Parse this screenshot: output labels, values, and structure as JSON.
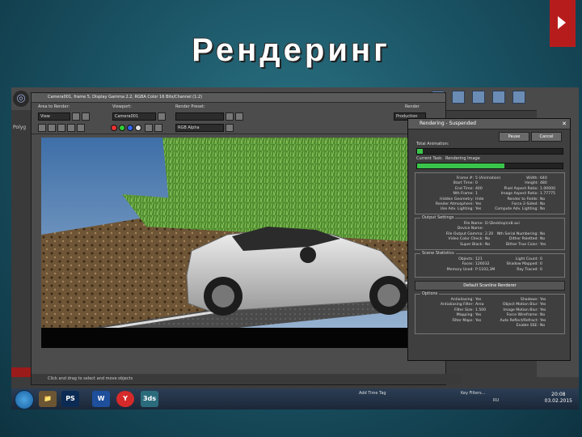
{
  "slide": {
    "title": "Рендеринг"
  },
  "max": {
    "side_labels": [
      "Polyg"
    ]
  },
  "frame": {
    "title": "Camera001, frame 5, Display Gamma 2.2, RGBA Color 16 Bits/Channel (1:2)",
    "area_label": "Area to Render:",
    "area_value": "View",
    "viewport_label": "Viewport:",
    "viewport_value": "Camera001",
    "preset_label": "Render Preset:",
    "channel_value": "RGB Alpha",
    "render_label": "Render",
    "render_value": "Production",
    "status": "Click and drag to select and move objects"
  },
  "rendering": {
    "title": "Rendering - Suspended",
    "pause_label": "Pause",
    "cancel_label": "Cancel",
    "total_label": "Total Animation:",
    "current_label": "Current Task:",
    "current_value": "Rendering Image",
    "total_progress": 0.04,
    "current_progress": 0.6,
    "common": [
      {
        "l": "Frame #:",
        "r": "5 (Animation)",
        "l2": "Width:",
        "r2": "640"
      },
      {
        "l": "Start Time:",
        "r": "0",
        "l2": "Height:",
        "r2": "480"
      },
      {
        "l": "End Time:",
        "r": "400",
        "l2": "Pixel Aspect Ratio:",
        "r2": "1.00000"
      },
      {
        "l": "Nth Frame:",
        "r": "1",
        "l2": "Image Aspect Ratio:",
        "r2": "1.77775"
      },
      {
        "l": "Hidden Geometry:",
        "r": "Hide",
        "l2": "Render to Fields:",
        "r2": "No"
      },
      {
        "l": "Render Atmosphere:",
        "r": "Yes",
        "l2": "Force 2-Sided:",
        "r2": "No"
      },
      {
        "l": "Use Adv. Lighting:",
        "r": "Yes",
        "l2": "Compute Adv. Lighting:",
        "r2": "No"
      }
    ],
    "output_title": "Output Settings",
    "output": [
      {
        "l": "File Name:",
        "r": "D:\\Desktop\\rx8.avi",
        "l2": "",
        "r2": ""
      },
      {
        "l": "Device Name:",
        "r": "",
        "l2": "",
        "r2": ""
      },
      {
        "l": "File Output Gamma:",
        "r": "2.20",
        "l2": "Nth Serial Numbering:",
        "r2": "No"
      },
      {
        "l": "Video Color Check:",
        "r": "No",
        "l2": "Dither Paletted:",
        "r2": "No"
      },
      {
        "l": "Super Black:",
        "r": "No",
        "l2": "Dither True Color:",
        "r2": "Yes"
      }
    ],
    "scene_title": "Scene Statistics",
    "scene": [
      {
        "l": "Objects:",
        "r": "121",
        "l2": "Light Count:",
        "r2": "0"
      },
      {
        "l": "Faces:",
        "r": "126032",
        "l2": "Shadow Mapped:",
        "r2": "0"
      },
      {
        "l": "Memory Used:",
        "r": "P:1102,3M",
        "l2": "Ray Traced:",
        "r2": "0"
      }
    ],
    "renderer_title": "Default Scanline Renderer",
    "options_label": "Options",
    "options": [
      {
        "l": "Antialiasing:",
        "r": "Yes",
        "l2": "Shadows:",
        "r2": "Yes"
      },
      {
        "l": "Antialiasing Filter:",
        "r": "Area",
        "l2": "Object Motion Blur:",
        "r2": "Yes"
      },
      {
        "l": "Filter Size:",
        "r": "1.500",
        "l2": "Image Motion Blur:",
        "r2": "Yes"
      },
      {
        "l": "Mapping:",
        "r": "Yes",
        "l2": "Force Wireframe:",
        "r2": "No"
      },
      {
        "l": "Filter Maps:",
        "r": "Yes",
        "l2": "Auto Reflect/Refract:",
        "r2": "Yes"
      },
      {
        "l": "",
        "r": "",
        "l2": "Enable SSE:",
        "r2": "No"
      }
    ]
  },
  "taskbar": {
    "add_time_tag": "Add Time Tag",
    "key_filters": "Key Filters...",
    "lang": "RU",
    "time": "20:08",
    "date": "03.02.2015",
    "apps": [
      "PS",
      "W",
      "Y",
      "3ds"
    ]
  }
}
